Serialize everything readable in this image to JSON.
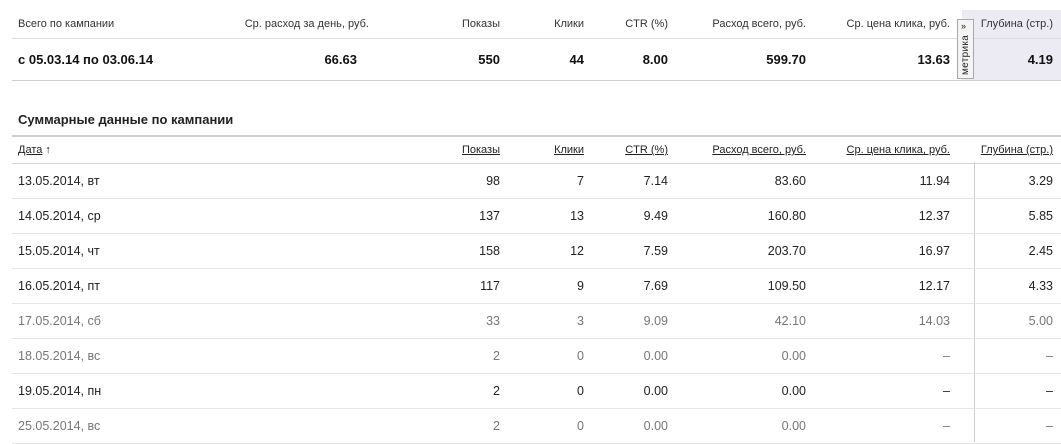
{
  "summary": {
    "headers": [
      "Всего по кампании",
      "Ср. расход за день, руб.",
      "Показы",
      "Клики",
      "CTR (%)",
      "Расход всего, руб.",
      "Ср. цена клика, руб.",
      "Глубина (стр.)"
    ],
    "period": "с 05.03.14 по 03.06.14",
    "values": [
      "66.63",
      "550",
      "44",
      "8.00",
      "599.70",
      "13.63",
      "4.19"
    ],
    "metrika_label": "метрика",
    "metrika_arrow": "»"
  },
  "details": {
    "title": "Суммарные данные по кампании",
    "headers": {
      "date": "Дата",
      "sort_arrow": "↑",
      "shows": "Показы",
      "clicks": "Клики",
      "ctr": "CTR (%)",
      "spend": "Расход всего, руб.",
      "cpc": "Ср. цена клика, руб.",
      "depth": "Глубина (стр.)"
    },
    "rows": [
      {
        "date": "13.05.2014, вт",
        "shows": "98",
        "clicks": "7",
        "ctr": "7.14",
        "spend": "83.60",
        "cpc": "11.94",
        "depth": "3.29",
        "dim": false
      },
      {
        "date": "14.05.2014, ср",
        "shows": "137",
        "clicks": "13",
        "ctr": "9.49",
        "spend": "160.80",
        "cpc": "12.37",
        "depth": "5.85",
        "dim": false
      },
      {
        "date": "15.05.2014, чт",
        "shows": "158",
        "clicks": "12",
        "ctr": "7.59",
        "spend": "203.70",
        "cpc": "16.97",
        "depth": "2.45",
        "dim": false
      },
      {
        "date": "16.05.2014, пт",
        "shows": "117",
        "clicks": "9",
        "ctr": "7.69",
        "spend": "109.50",
        "cpc": "12.17",
        "depth": "4.33",
        "dim": false
      },
      {
        "date": "17.05.2014, сб",
        "shows": "33",
        "clicks": "3",
        "ctr": "9.09",
        "spend": "42.10",
        "cpc": "14.03",
        "depth": "5.00",
        "dim": true
      },
      {
        "date": "18.05.2014, вс",
        "shows": "2",
        "clicks": "0",
        "ctr": "0.00",
        "spend": "0.00",
        "cpc": "–",
        "depth": "–",
        "dim": true
      },
      {
        "date": "19.05.2014, пн",
        "shows": "2",
        "clicks": "0",
        "ctr": "0.00",
        "spend": "0.00",
        "cpc": "–",
        "depth": "–",
        "dim": false
      },
      {
        "date": "25.05.2014, вс",
        "shows": "2",
        "clicks": "0",
        "ctr": "0.00",
        "spend": "0.00",
        "cpc": "–",
        "depth": "–",
        "dim": true
      }
    ]
  },
  "colors": {
    "depth_shade": "#eceaf3",
    "dim_text": "#777777"
  }
}
